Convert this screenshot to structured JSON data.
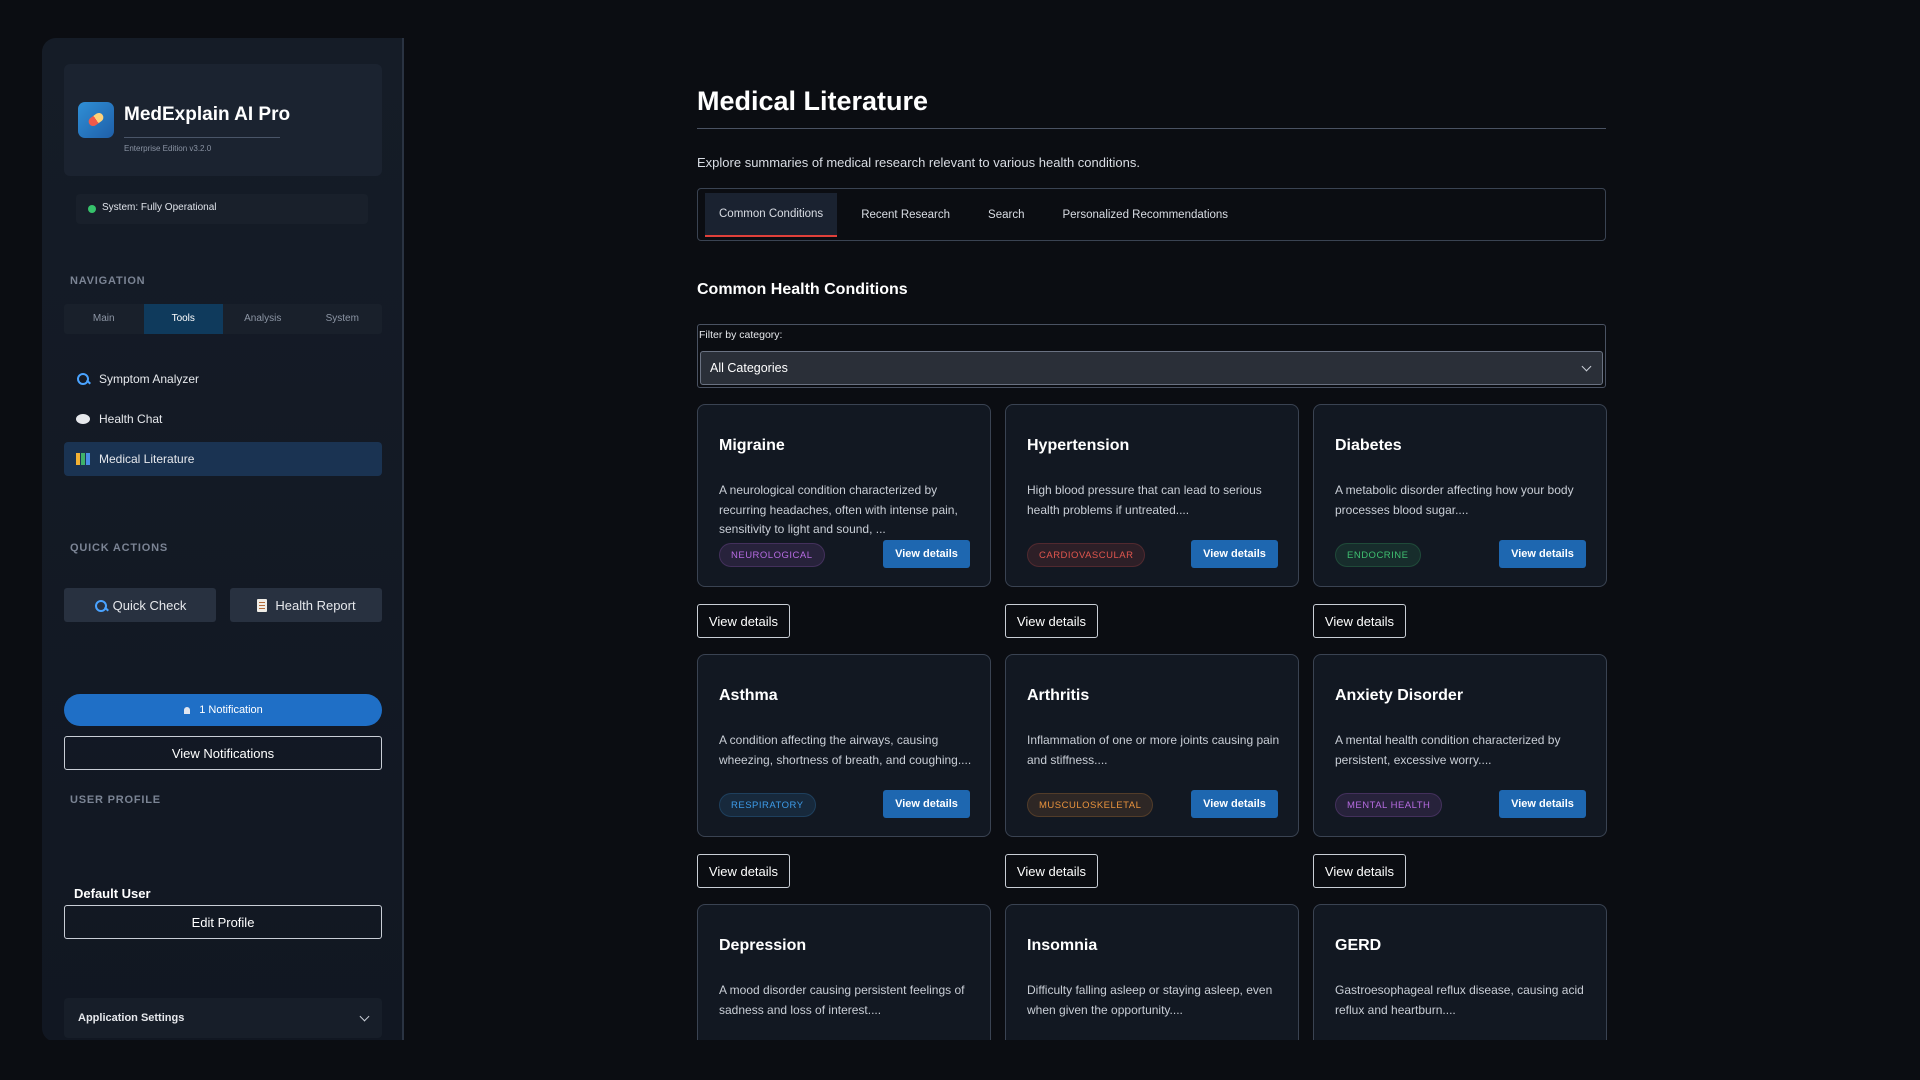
{
  "app": {
    "name": "MedExplain AI Pro",
    "edition": "Enterprise Edition v3.2.0",
    "status": "System: Fully Operational"
  },
  "sidebar": {
    "nav_label": "NAVIGATION",
    "nav_tabs": [
      "Main",
      "Tools",
      "Analysis",
      "System"
    ],
    "active_tab": "Tools",
    "items": [
      {
        "label": "Symptom Analyzer",
        "icon": "search-icon"
      },
      {
        "label": "Health Chat",
        "icon": "chat-bubble-icon"
      },
      {
        "label": "Medical Literature",
        "icon": "books-icon",
        "active": true
      }
    ],
    "quick_actions_label": "QUICK ACTIONS",
    "quick_actions": [
      {
        "label": "Quick Check",
        "icon": "search-icon"
      },
      {
        "label": "Health Report",
        "icon": "report-icon"
      }
    ],
    "notification_label": "1 Notification",
    "view_notifications_label": "View Notifications",
    "user_profile_label": "USER PROFILE",
    "user_name": "Default User",
    "edit_profile_label": "Edit Profile",
    "settings_label": "Application Settings"
  },
  "main": {
    "title": "Medical Literature",
    "description": "Explore summaries of medical research relevant to various health conditions.",
    "tabs": [
      "Common Conditions",
      "Recent Research",
      "Search",
      "Personalized Recommendations"
    ],
    "active_tab": "Common Conditions",
    "section_title": "Common Health Conditions",
    "filter_label": "Filter by category:",
    "filter_value": "All Categories",
    "card_button_label": "View details",
    "external_button_label": "View details",
    "conditions": [
      {
        "name": "Migraine",
        "description": "A neurological condition characterized by recurring headaches, often with intense pain, sensitivity to light and sound, ...",
        "category": "NEUROLOGICAL",
        "color": "#b56be0"
      },
      {
        "name": "Hypertension",
        "description": "High blood pressure that can lead to serious health problems if untreated....",
        "category": "CARDIOVASCULAR",
        "color": "#e0564e"
      },
      {
        "name": "Diabetes",
        "description": "A metabolic disorder affecting how your body processes blood sugar....",
        "category": "ENDOCRINE",
        "color": "#3fbf70"
      },
      {
        "name": "Asthma",
        "description": "A condition affecting the airways, causing wheezing, shortness of breath, and coughing....",
        "category": "RESPIRATORY",
        "color": "#3d9be8"
      },
      {
        "name": "Arthritis",
        "description": "Inflammation of one or more joints causing pain and stiffness....",
        "category": "MUSCULOSKELETAL",
        "color": "#e8923d"
      },
      {
        "name": "Anxiety Disorder",
        "description": "A mental health condition characterized by persistent, excessive worry....",
        "category": "MENTAL HEALTH",
        "color": "#b56be0"
      },
      {
        "name": "Depression",
        "description": "A mood disorder causing persistent feelings of sadness and loss of interest....",
        "category": "",
        "color": "#b56be0"
      },
      {
        "name": "Insomnia",
        "description": "Difficulty falling asleep or staying asleep, even when given the opportunity....",
        "category": "",
        "color": "#b56be0"
      },
      {
        "name": "GERD",
        "description": "Gastroesophageal reflux disease, causing acid reflux and heartburn....",
        "category": "",
        "color": "#e8923d"
      }
    ]
  }
}
